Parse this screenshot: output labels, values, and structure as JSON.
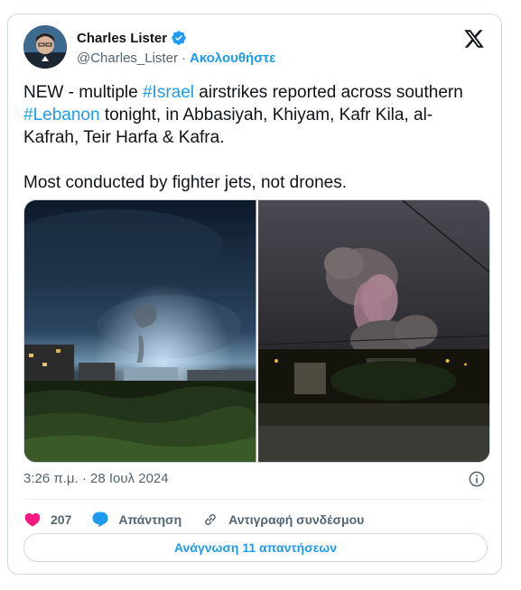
{
  "author": {
    "name": "Charles Lister",
    "handle": "@Charles_Lister",
    "separator": "·",
    "follow_label": "Ακολουθήστε"
  },
  "tweet": {
    "t1": "NEW - multiple ",
    "h1": "#Israel",
    "t2": " airstrikes reported across southern ",
    "h2": "#Lebanon",
    "t3": " tonight, in Abbasiyah, Khiyam, Kafr Kila, al-Kafrah, Teir Harfa & Kafra.\n\nMost conducted by fighter jets, not drones."
  },
  "timestamp": "3:26 π.μ. · 28 Ιουλ 2024",
  "actions": {
    "likes": "207",
    "reply_label": "Απάντηση",
    "copy_link_label": "Αντιγραφή συνδέσμου"
  },
  "read_replies_label": "Ανάγνωση 11 απαντήσεων",
  "colors": {
    "accent": "#1d9bf0",
    "like": "#f91880",
    "text": "#0f1419",
    "muted": "#536471"
  },
  "icons": [
    "verified-badge-icon",
    "x-logo-icon",
    "info-icon",
    "heart-icon",
    "reply-bubble-icon",
    "link-icon"
  ]
}
